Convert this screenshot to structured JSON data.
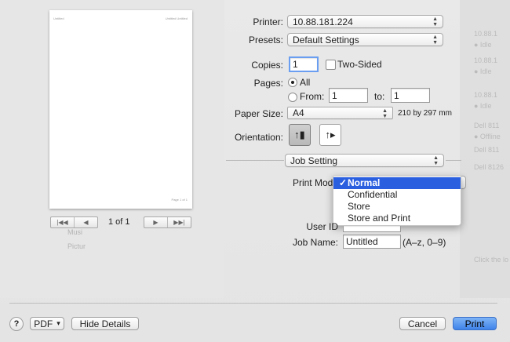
{
  "background": {
    "right_ghost": [
      "10.88.1",
      "● Idle",
      "10.88.1",
      "● Idle",
      "10.88.1",
      "● Idle",
      "Dell 811",
      "● Offline",
      "Dell 811",
      "Dell 8126",
      "Click the lo"
    ],
    "left_ghost": [
      "Musi",
      "Pictur"
    ]
  },
  "preview": {
    "header_left": "Untitled",
    "header_right": "Untitled Untitled",
    "footer": "Page 1 of 1",
    "nav_first": "|◀◀",
    "nav_prev": "◀",
    "nav_next": "▶",
    "nav_last": "▶▶|",
    "page_count": "1 of 1"
  },
  "printer": {
    "label": "Printer:",
    "value": "10.88.181.224"
  },
  "presets": {
    "label": "Presets:",
    "value": "Default Settings"
  },
  "copies": {
    "label": "Copies:",
    "value": "1",
    "two_sided_label": "Two-Sided"
  },
  "pages": {
    "label": "Pages:",
    "all_label": "All",
    "from_label": "From:",
    "from_value": "1",
    "to_label": "to:",
    "to_value": "1"
  },
  "paper_size": {
    "label": "Paper Size:",
    "value": "A4",
    "dimensions": "210 by 297 mm"
  },
  "orientation": {
    "label": "Orientation:"
  },
  "section": {
    "value": "Job Setting"
  },
  "print_mode": {
    "label": "Print Mode",
    "options": [
      "Normal",
      "Confidential",
      "Store",
      "Store and Print"
    ],
    "selected": "Normal",
    "tick": "✓"
  },
  "user_id": {
    "label": "User ID"
  },
  "job_name": {
    "label": "Job Name:",
    "value": "Untitled",
    "hint": "(A–z, 0–9)"
  },
  "footer": {
    "help_label": "?",
    "pdf_label": "PDF",
    "pdf_arrow": "▾",
    "hide_details_label": "Hide Details",
    "cancel_label": "Cancel",
    "print_label": "Print"
  },
  "colors": {
    "accent": "#2a5fe0",
    "primary_button": "#3f83ea",
    "focus_ring": "#6a9ef0"
  }
}
